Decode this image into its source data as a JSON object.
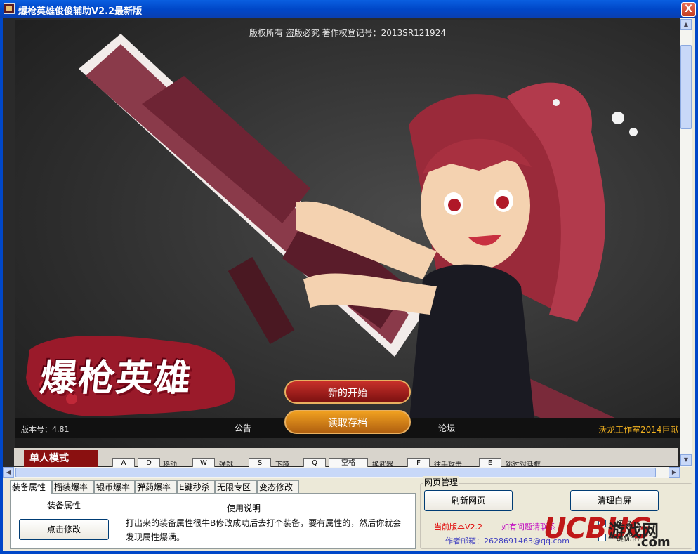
{
  "window": {
    "title": "爆枪英雄俊俊辅助V2.2最新版",
    "close_label": "X"
  },
  "game": {
    "copyright": "版权所有 盗版必究 著作权登记号：2013SR121924",
    "logo": "爆枪英雄",
    "btn_new": "新的开始",
    "btn_load": "读取存档",
    "version": "版本号：4.81",
    "notice": "公告",
    "forum": "论坛",
    "studio": "沃龙工作室2014巨献",
    "mode_tab": "单人模式",
    "keys": [
      {
        "key": "A",
        "desc": ""
      },
      {
        "key": "D",
        "desc": "移动"
      },
      {
        "key": "W",
        "desc": "弹跳"
      },
      {
        "key": "S",
        "desc": "下蹲"
      },
      {
        "key": "Q",
        "desc": ""
      },
      {
        "key": "空格",
        "desc": "换武器"
      },
      {
        "key": "F",
        "desc": "往手攻击"
      },
      {
        "key": "E",
        "desc": "跳过对话框"
      }
    ]
  },
  "tabs": [
    {
      "label": "装备属性",
      "active": true
    },
    {
      "label": "榴装爆率"
    },
    {
      "label": "银币爆率"
    },
    {
      "label": "弹药爆率"
    },
    {
      "label": "E键秒杀"
    },
    {
      "label": "无限专区"
    },
    {
      "label": "变态修改"
    }
  ],
  "panel": {
    "equip_label": "装备属性",
    "modify_button": "点击修改",
    "usage_title": "使用说明",
    "usage_text": "打出来的装备属性很牛B修改成功后去打个装备，要有属性的，然后你就会发现属性爆满。"
  },
  "web": {
    "group_title": "网页管理",
    "refresh_button": "刷新网页",
    "clear_button": "清理白屏",
    "current_version": "当前版本V2.2",
    "contact": "如有问题请联系",
    "email": "作者邮箱：2628691463@qq.com",
    "check1": "按钮窗口",
    "check2": "一键优化"
  },
  "watermark": {
    "brand": "UCBUG",
    "cn": "游戏网",
    "com": ".com"
  }
}
